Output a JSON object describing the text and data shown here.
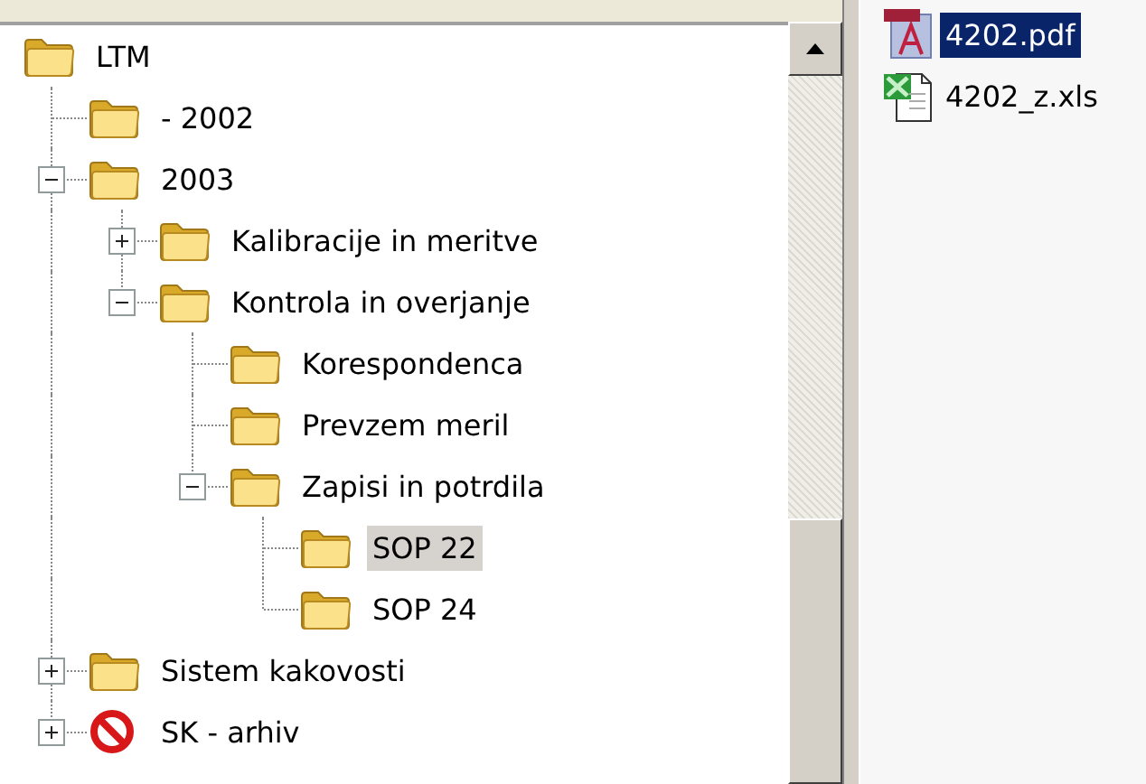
{
  "tree": {
    "nodes": [
      {
        "label": "LTM",
        "kind": "folder",
        "selected": false,
        "children": [
          {
            "label": "- 2002",
            "kind": "folder",
            "selected": false
          },
          {
            "label": "2003",
            "kind": "folder",
            "selected": false,
            "expanded": true,
            "children": [
              {
                "label": "Kalibracije in meritve",
                "kind": "folder",
                "selected": false,
                "expanded": false
              },
              {
                "label": "Kontrola in overjanje",
                "kind": "folder",
                "selected": false,
                "expanded": true,
                "children": [
                  {
                    "label": "Korespondenca",
                    "kind": "folder",
                    "selected": false
                  },
                  {
                    "label": "Prevzem meril",
                    "kind": "folder",
                    "selected": false
                  },
                  {
                    "label": "Zapisi in potrdila",
                    "kind": "folder",
                    "selected": false,
                    "expanded": true,
                    "children": [
                      {
                        "label": "SOP 22",
                        "kind": "folder",
                        "selected": true
                      },
                      {
                        "label": "SOP 24",
                        "kind": "folder",
                        "selected": false
                      }
                    ]
                  }
                ]
              }
            ]
          },
          {
            "label": "Sistem kakovosti",
            "kind": "folder",
            "selected": false,
            "expanded": false
          },
          {
            "label": "SK - arhiv",
            "kind": "forbidden",
            "selected": false,
            "expanded": false
          }
        ]
      }
    ]
  },
  "files": [
    {
      "name": "4202.pdf",
      "kind": "pdf",
      "selected": true
    },
    {
      "name": "4202_z.xls",
      "kind": "xls",
      "selected": false
    }
  ]
}
